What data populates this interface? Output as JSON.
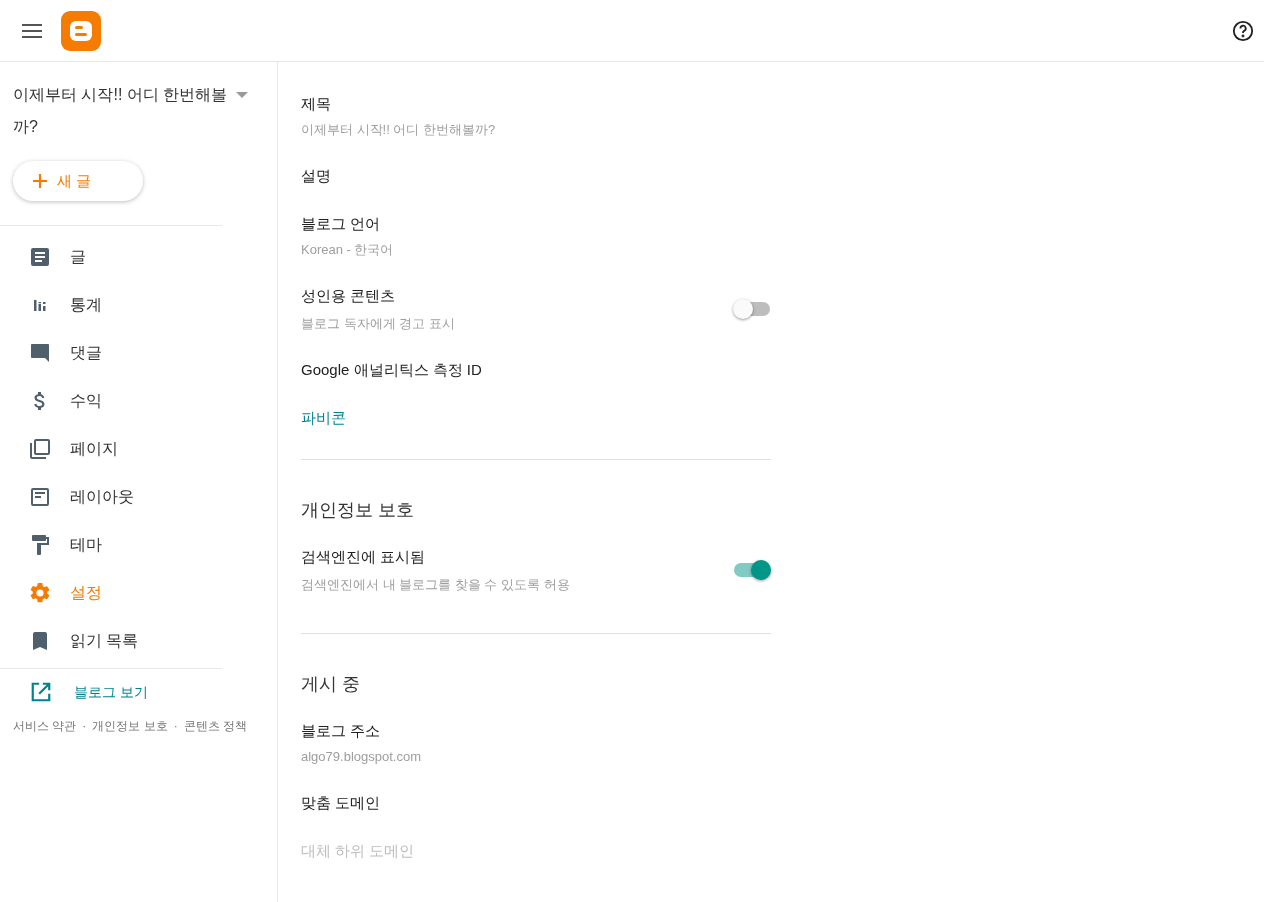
{
  "blog_selector": {
    "title": "이제부터 시작!! 어디 한번해볼까?"
  },
  "new_post_button": {
    "label": "새 글"
  },
  "nav": [
    {
      "label": "글",
      "selected": false
    },
    {
      "label": "통계",
      "selected": false
    },
    {
      "label": "댓글",
      "selected": false
    },
    {
      "label": "수익",
      "selected": false
    },
    {
      "label": "페이지",
      "selected": false
    },
    {
      "label": "레이아웃",
      "selected": false
    },
    {
      "label": "테마",
      "selected": false
    },
    {
      "label": "설정",
      "selected": true
    },
    {
      "label": "읽기 목록",
      "selected": false
    }
  ],
  "view_blog_link": {
    "label": "블로그 보기"
  },
  "footer": [
    {
      "kind": "link",
      "text": "서비스 약관"
    },
    {
      "kind": "separator",
      "text": "·"
    },
    {
      "kind": "link",
      "text": "개인정보 보호"
    },
    {
      "kind": "separator",
      "text": "·"
    },
    {
      "kind": "link",
      "text": "콘텐츠 정책"
    }
  ],
  "sections": [
    {
      "items": [
        {
          "kind": "field",
          "label": "제목",
          "value": "이제부터 시작!! 어디 한번해볼까?"
        },
        {
          "kind": "field",
          "label": "설명"
        },
        {
          "kind": "field",
          "label": "블로그 언어",
          "value": "Korean - 한국어"
        },
        {
          "kind": "toggle",
          "label": "성인용 콘텐츠",
          "description": "블로그 독자에게 경고 표시",
          "on": false
        },
        {
          "kind": "field",
          "label": "Google 애널리틱스 측정 ID"
        },
        {
          "kind": "link",
          "label": "파비콘"
        }
      ]
    },
    {
      "heading": "개인정보 보호",
      "items": [
        {
          "kind": "toggle",
          "label": "검색엔진에 표시됨",
          "description": "검색엔진에서 내 블로그를 찾을 수 있도록 허용",
          "on": true
        }
      ]
    },
    {
      "heading": "게시 중",
      "items": [
        {
          "kind": "field",
          "label": "블로그 주소",
          "value": "algo79.blogspot.com"
        },
        {
          "kind": "field",
          "label": "맞춤 도메인"
        },
        {
          "kind": "disabled",
          "label": "대체 하위 도메인"
        }
      ]
    }
  ]
}
